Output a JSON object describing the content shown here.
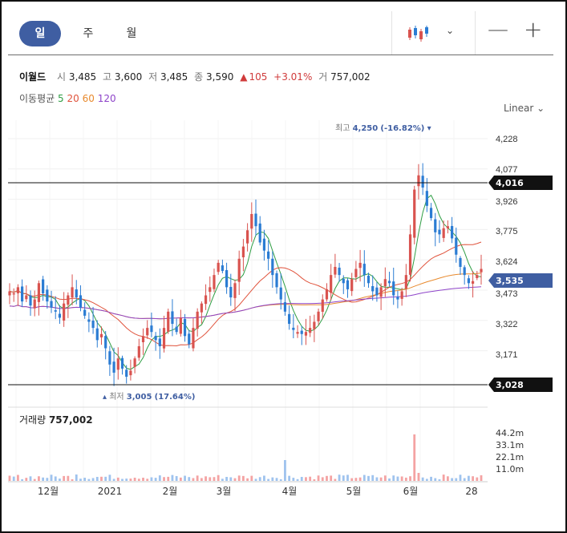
{
  "tabs": {
    "day": "일",
    "week": "주",
    "month": "월"
  },
  "toolbar": {
    "candle_icon": "candlestick-icon",
    "chevron": "⌄",
    "zoom_out": "—",
    "zoom_in": "+"
  },
  "stock": {
    "name": "이월드",
    "open_label": "시",
    "open": "3,485",
    "high_label": "고",
    "high": "3,600",
    "low_label": "저",
    "low": "3,485",
    "close_label": "종",
    "close": "3,590",
    "change_arrow": "▲",
    "change": "105",
    "change_pct": "+3.01%",
    "volume_label": "거",
    "volume": "757,002"
  },
  "moving_average": {
    "label": "이동평균",
    "periods": [
      {
        "value": "5",
        "color": "#2f9e44"
      },
      {
        "value": "20",
        "color": "#e0533c"
      },
      {
        "value": "60",
        "color": "#e88a2e"
      },
      {
        "value": "120",
        "color": "#8e44c9"
      }
    ]
  },
  "scale_label": "Linear",
  "colors": {
    "up": "#d9534f",
    "down": "#2b7cd3",
    "accent": "#3f5ea2"
  },
  "chart_data": {
    "type": "candlestick",
    "yticks": [
      "4,228",
      "4,077",
      "3,926",
      "3,775",
      "3,624",
      "3,473",
      "3,322",
      "3,171"
    ],
    "xticks": [
      "12월",
      "2021",
      "2월",
      "3월",
      "4월",
      "5월",
      "6월",
      "28"
    ],
    "markers": {
      "high": {
        "label": "최고",
        "value": "4,250",
        "pct": "(-16.82%)"
      },
      "low": {
        "label": "최저",
        "value": "3,005",
        "pct": "(17.64%)"
      }
    },
    "price_tags": [
      {
        "value": "4,016",
        "style": "dark"
      },
      {
        "value": "3,535",
        "style": "accent"
      },
      {
        "value": "3,028",
        "style": "dark"
      }
    ],
    "volume": {
      "label": "거래량",
      "value": "757,002",
      "yticks": [
        "44.2m",
        "33.1m",
        "22.1m",
        "11.0m"
      ]
    },
    "closes": [
      3480,
      3470,
      3500,
      3430,
      3460,
      3410,
      3440,
      3520,
      3470,
      3430,
      3400,
      3380,
      3350,
      3420,
      3460,
      3500,
      3450,
      3400,
      3360,
      3330,
      3300,
      3240,
      3270,
      3200,
      3120,
      3080,
      3150,
      3100,
      3060,
      3090,
      3150,
      3210,
      3260,
      3300,
      3280,
      3240,
      3210,
      3300,
      3380,
      3320,
      3280,
      3350,
      3260,
      3220,
      3300,
      3380,
      3420,
      3460,
      3500,
      3560,
      3620,
      3580,
      3500,
      3450,
      3520,
      3640,
      3700,
      3780,
      3860,
      3800,
      3720,
      3680,
      3640,
      3560,
      3500,
      3440,
      3380,
      3320,
      3290,
      3280,
      3270,
      3280,
      3300,
      3330,
      3380,
      3440,
      3490,
      3560,
      3600,
      3560,
      3520,
      3490,
      3540,
      3590,
      3620,
      3560,
      3520,
      3480,
      3460,
      3500,
      3540,
      3520,
      3460,
      3440,
      3480,
      3560,
      3760,
      3980,
      4050,
      3990,
      3900,
      3840,
      3770,
      3760,
      3790,
      3800,
      3740,
      3660,
      3600,
      3560,
      3520,
      3530,
      3560,
      3590
    ]
  }
}
